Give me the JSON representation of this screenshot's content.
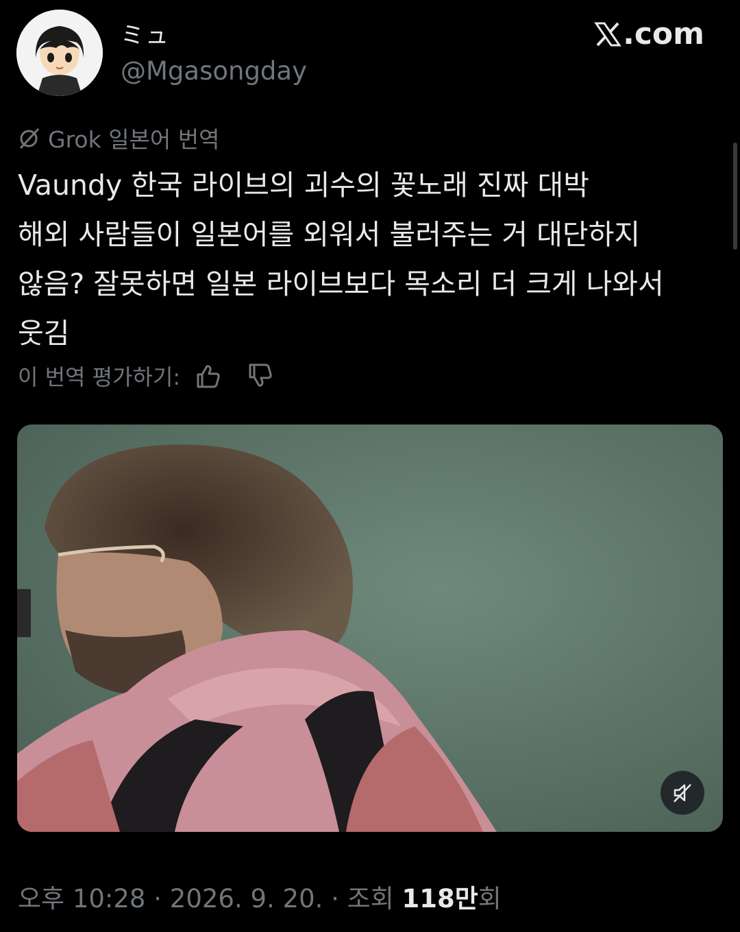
{
  "author": {
    "display_name": "ミュ",
    "handle": "@Mgasongday"
  },
  "brand": {
    "label": ".com"
  },
  "translation": {
    "label": "Grok 일본어 번역"
  },
  "tweet": {
    "lines": [
      "Vaundy 한국 라이브의 괴수의 꽃노래 진짜 대박",
      "해외 사람들이 일본어를 외워서 불러주는 거 대단하지",
      "않음? 잘못하면 일본 라이브보다 목소리 더 크게 나와서",
      "웃김"
    ]
  },
  "rating": {
    "label": "이 번역 평가하기:"
  },
  "media": {
    "mute_icon": "muted-speaker-icon"
  },
  "meta": {
    "time": "오후 10:28",
    "separator": " · ",
    "date": "2026. 9. 20.",
    "views_label": "조회 ",
    "views_value": "118만",
    "views_suffix": "회"
  },
  "colors": {
    "background": "#000000",
    "text": "#e7e9ea",
    "muted": "#71767b"
  }
}
